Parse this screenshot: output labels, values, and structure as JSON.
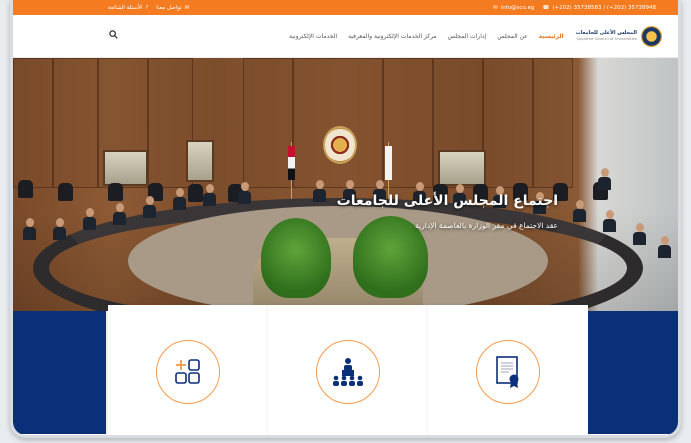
{
  "topbar": {
    "faq_label": "الأسئلة الشائعة",
    "contact_label": "تواصل معنا",
    "email": "info@scu.eg",
    "phone": "(+202) 35738583 / (+202) 35738948"
  },
  "header": {
    "logo_ar": "المجلس الأعلى للجامعات",
    "logo_en": "Supreme Council of Universities",
    "nav": [
      {
        "label": "الرئيسية",
        "active": true
      },
      {
        "label": "عن المجلس",
        "active": false
      },
      {
        "label": "إدارات المجلس",
        "active": false
      },
      {
        "label": "مركز الخدمات الإلكترونية والمعرفية",
        "active": false
      },
      {
        "label": "الخدمات الإلكترونية",
        "active": false
      }
    ]
  },
  "hero": {
    "title": "اجتماع المجلس الأعلى للجامعات",
    "subtitle": "عقد الاجتماع في مقر الوزارة بالعاصمة الإدارية"
  },
  "cards": [
    {
      "icon": "apps-plus-icon"
    },
    {
      "icon": "meeting-speaker-icon"
    },
    {
      "icon": "certificate-icon"
    }
  ],
  "colors": {
    "topbar": "#f47b20",
    "navy": "#0c2f7a",
    "accent": "#e8731e"
  }
}
